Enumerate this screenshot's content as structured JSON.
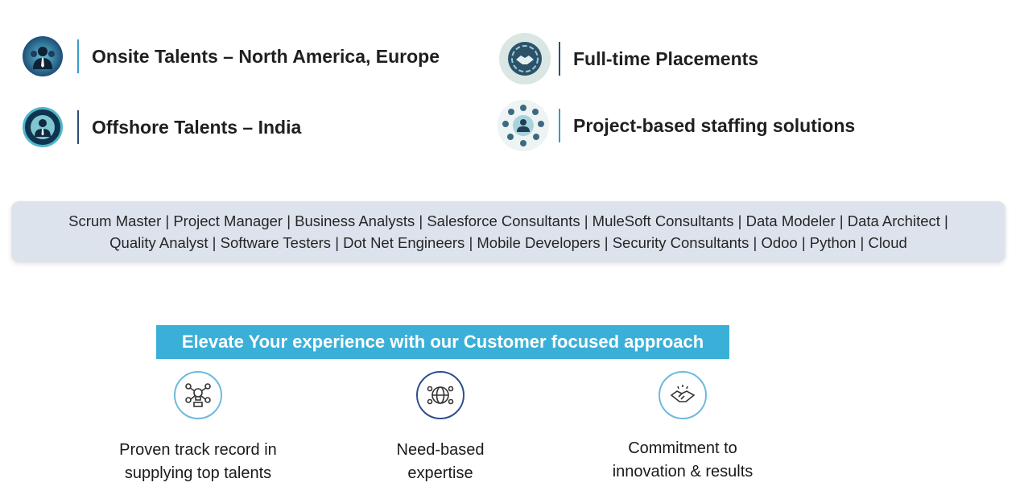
{
  "services": [
    {
      "label": "Onsite Talents – North America, Europe",
      "icon": "business-people-icon",
      "divider_color": "#3a9bc8"
    },
    {
      "label": "Offshore Talents – India",
      "icon": "person-badge-icon",
      "divider_color": "#2c4f7a"
    },
    {
      "label": "Full-time Placements",
      "icon": "handshake-icon",
      "divider_color": "#2c4f7a"
    },
    {
      "label": "Project-based staffing solutions",
      "icon": "team-network-icon",
      "divider_color": "#3a9bc8"
    }
  ],
  "roles": {
    "line1": "Scrum Master | Project Manager | Business Analysts | Salesforce Consultants | MuleSoft Consultants | Data Modeler | Data Architect |",
    "line2": "Quality Analyst | Software Testers | Dot Net Engineers | Mobile Developers | Security Consultants | Odoo | Python | Cloud"
  },
  "banner": {
    "title": "Elevate Your experience with our Customer focused approach",
    "color": "#3ab0d8"
  },
  "features": [
    {
      "line1": "Proven track record in",
      "line2": "supplying top talents",
      "icon": "ideas-network-icon"
    },
    {
      "line1": "Need-based",
      "line2": "expertise",
      "icon": "globe-network-icon"
    },
    {
      "line1": "Commitment to",
      "line2": "innovation & results",
      "icon": "handshake-icon"
    }
  ]
}
